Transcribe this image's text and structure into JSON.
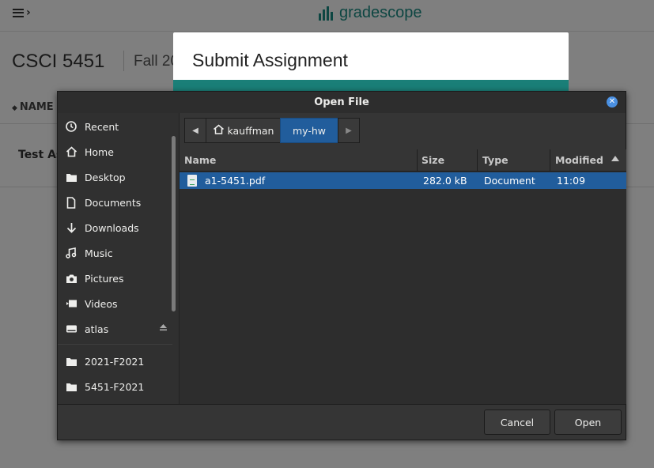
{
  "background": {
    "brand": "gradescope",
    "course_code": "CSCI 5451",
    "course_term": "Fall 20",
    "column_header": "NAME",
    "assignment_row": "Test As"
  },
  "modal": {
    "title": "Submit Assignment"
  },
  "dialog": {
    "title": "Open File",
    "sidebar": {
      "places": [
        {
          "label": "Recent",
          "icon": "clock-icon"
        },
        {
          "label": "Home",
          "icon": "home-icon"
        },
        {
          "label": "Desktop",
          "icon": "folder-icon"
        },
        {
          "label": "Documents",
          "icon": "document-icon"
        },
        {
          "label": "Downloads",
          "icon": "download-icon"
        },
        {
          "label": "Music",
          "icon": "music-icon"
        },
        {
          "label": "Pictures",
          "icon": "camera-icon"
        },
        {
          "label": "Videos",
          "icon": "video-icon"
        },
        {
          "label": "atlas",
          "icon": "drive-icon"
        }
      ],
      "bookmarks": [
        {
          "label": "2021-F2021",
          "icon": "folder-icon"
        },
        {
          "label": "5451-F2021",
          "icon": "folder-icon"
        }
      ]
    },
    "pathbar": {
      "home": "kauffman",
      "current": "my-hw"
    },
    "columns": {
      "name": "Name",
      "size": "Size",
      "type": "Type",
      "modified": "Modified"
    },
    "files": [
      {
        "name": "a1-5451.pdf",
        "size": "282.0 kB",
        "type": "Document",
        "modified": "11:09",
        "selected": true
      }
    ],
    "buttons": {
      "cancel": "Cancel",
      "open": "Open"
    },
    "colors": {
      "selection": "#215d9c",
      "close_button": "#4a90e2",
      "brand": "#1b8d85"
    }
  }
}
